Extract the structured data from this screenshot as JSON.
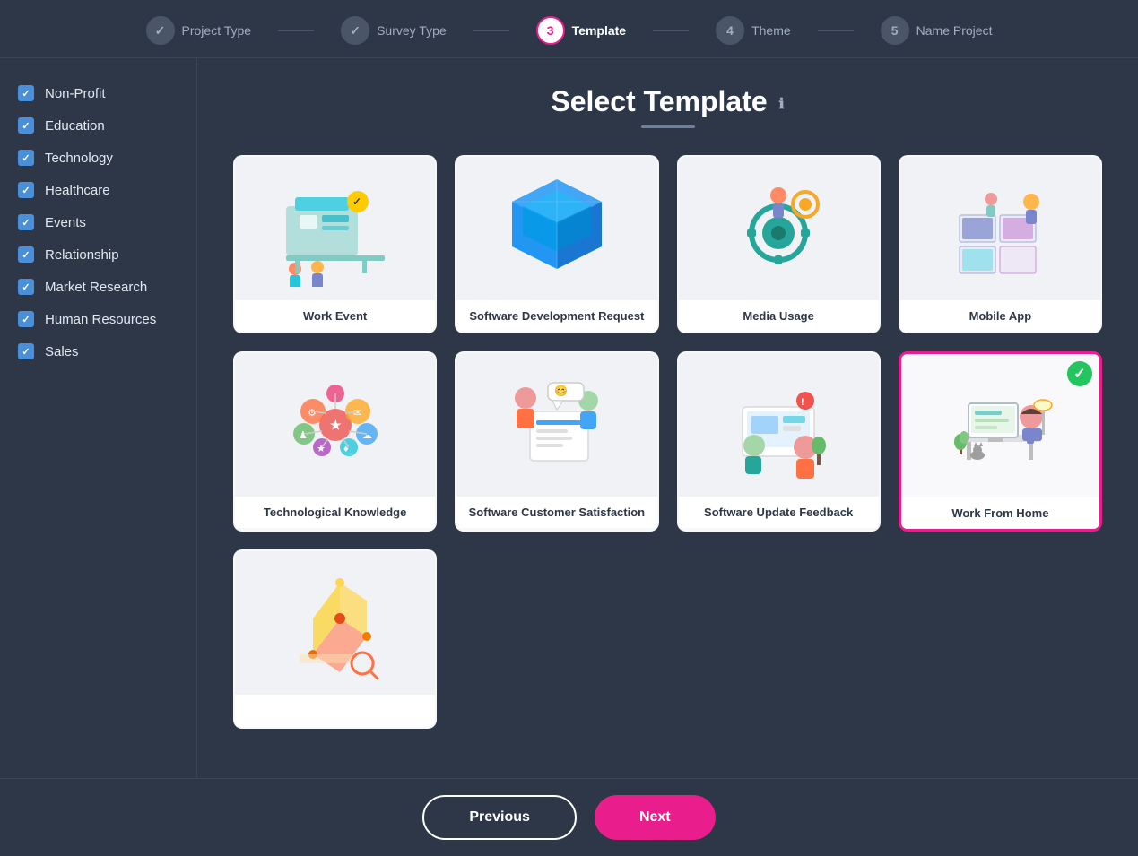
{
  "steps": [
    {
      "id": "project-type",
      "number": "✓",
      "label": "Project Type",
      "state": "done"
    },
    {
      "id": "survey-type",
      "number": "✓",
      "label": "Survey Type",
      "state": "done"
    },
    {
      "id": "template",
      "number": "3",
      "label": "Template",
      "state": "active"
    },
    {
      "id": "theme",
      "number": "4",
      "label": "Theme",
      "state": "inactive"
    },
    {
      "id": "name-project",
      "number": "5",
      "label": "Name Project",
      "state": "inactive"
    }
  ],
  "sidebar": {
    "items": [
      {
        "id": "non-profit",
        "label": "Non-Profit",
        "checked": true
      },
      {
        "id": "education",
        "label": "Education",
        "checked": true
      },
      {
        "id": "technology",
        "label": "Technology",
        "checked": true
      },
      {
        "id": "healthcare",
        "label": "Healthcare",
        "checked": true
      },
      {
        "id": "events",
        "label": "Events",
        "checked": true
      },
      {
        "id": "relationship",
        "label": "Relationship",
        "checked": true
      },
      {
        "id": "market-research",
        "label": "Market Research",
        "checked": true
      },
      {
        "id": "human-resources",
        "label": "Human Resources",
        "checked": true
      },
      {
        "id": "sales",
        "label": "Sales",
        "checked": true
      }
    ]
  },
  "page": {
    "title": "Select Template",
    "info_icon": "ℹ"
  },
  "templates": [
    {
      "id": "work-event",
      "label": "Work Event",
      "selected": false,
      "color1": "#4dd0e1",
      "color2": "#26c6da"
    },
    {
      "id": "software-development-request",
      "label": "Software Development Request",
      "selected": false,
      "color1": "#1565c0",
      "color2": "#42a5f5"
    },
    {
      "id": "media-usage",
      "label": "Media Usage",
      "selected": false,
      "color1": "#26a69a",
      "color2": "#f9a825"
    },
    {
      "id": "mobile-app",
      "label": "Mobile App",
      "selected": false,
      "color1": "#7986cb",
      "color2": "#ce93d8"
    },
    {
      "id": "technological-knowledge",
      "label": "Technological Knowledge",
      "selected": false,
      "color1": "#ef5350",
      "color2": "#ff7043"
    },
    {
      "id": "software-customer-satisfaction",
      "label": "Software Customer Satisfaction",
      "selected": false,
      "color1": "#42a5f5",
      "color2": "#26c6da"
    },
    {
      "id": "software-update-feedback",
      "label": "Software Update Feedback",
      "selected": false,
      "color1": "#f4511e",
      "color2": "#26a69a"
    },
    {
      "id": "work-from-home",
      "label": "Work From Home",
      "selected": true,
      "color1": "#7986cb",
      "color2": "#a5d6a7"
    },
    {
      "id": "row3-item1",
      "label": "",
      "selected": false,
      "color1": "#ff8a65",
      "color2": "#ffd54f"
    }
  ],
  "footer": {
    "prev_label": "Previous",
    "next_label": "Next"
  }
}
